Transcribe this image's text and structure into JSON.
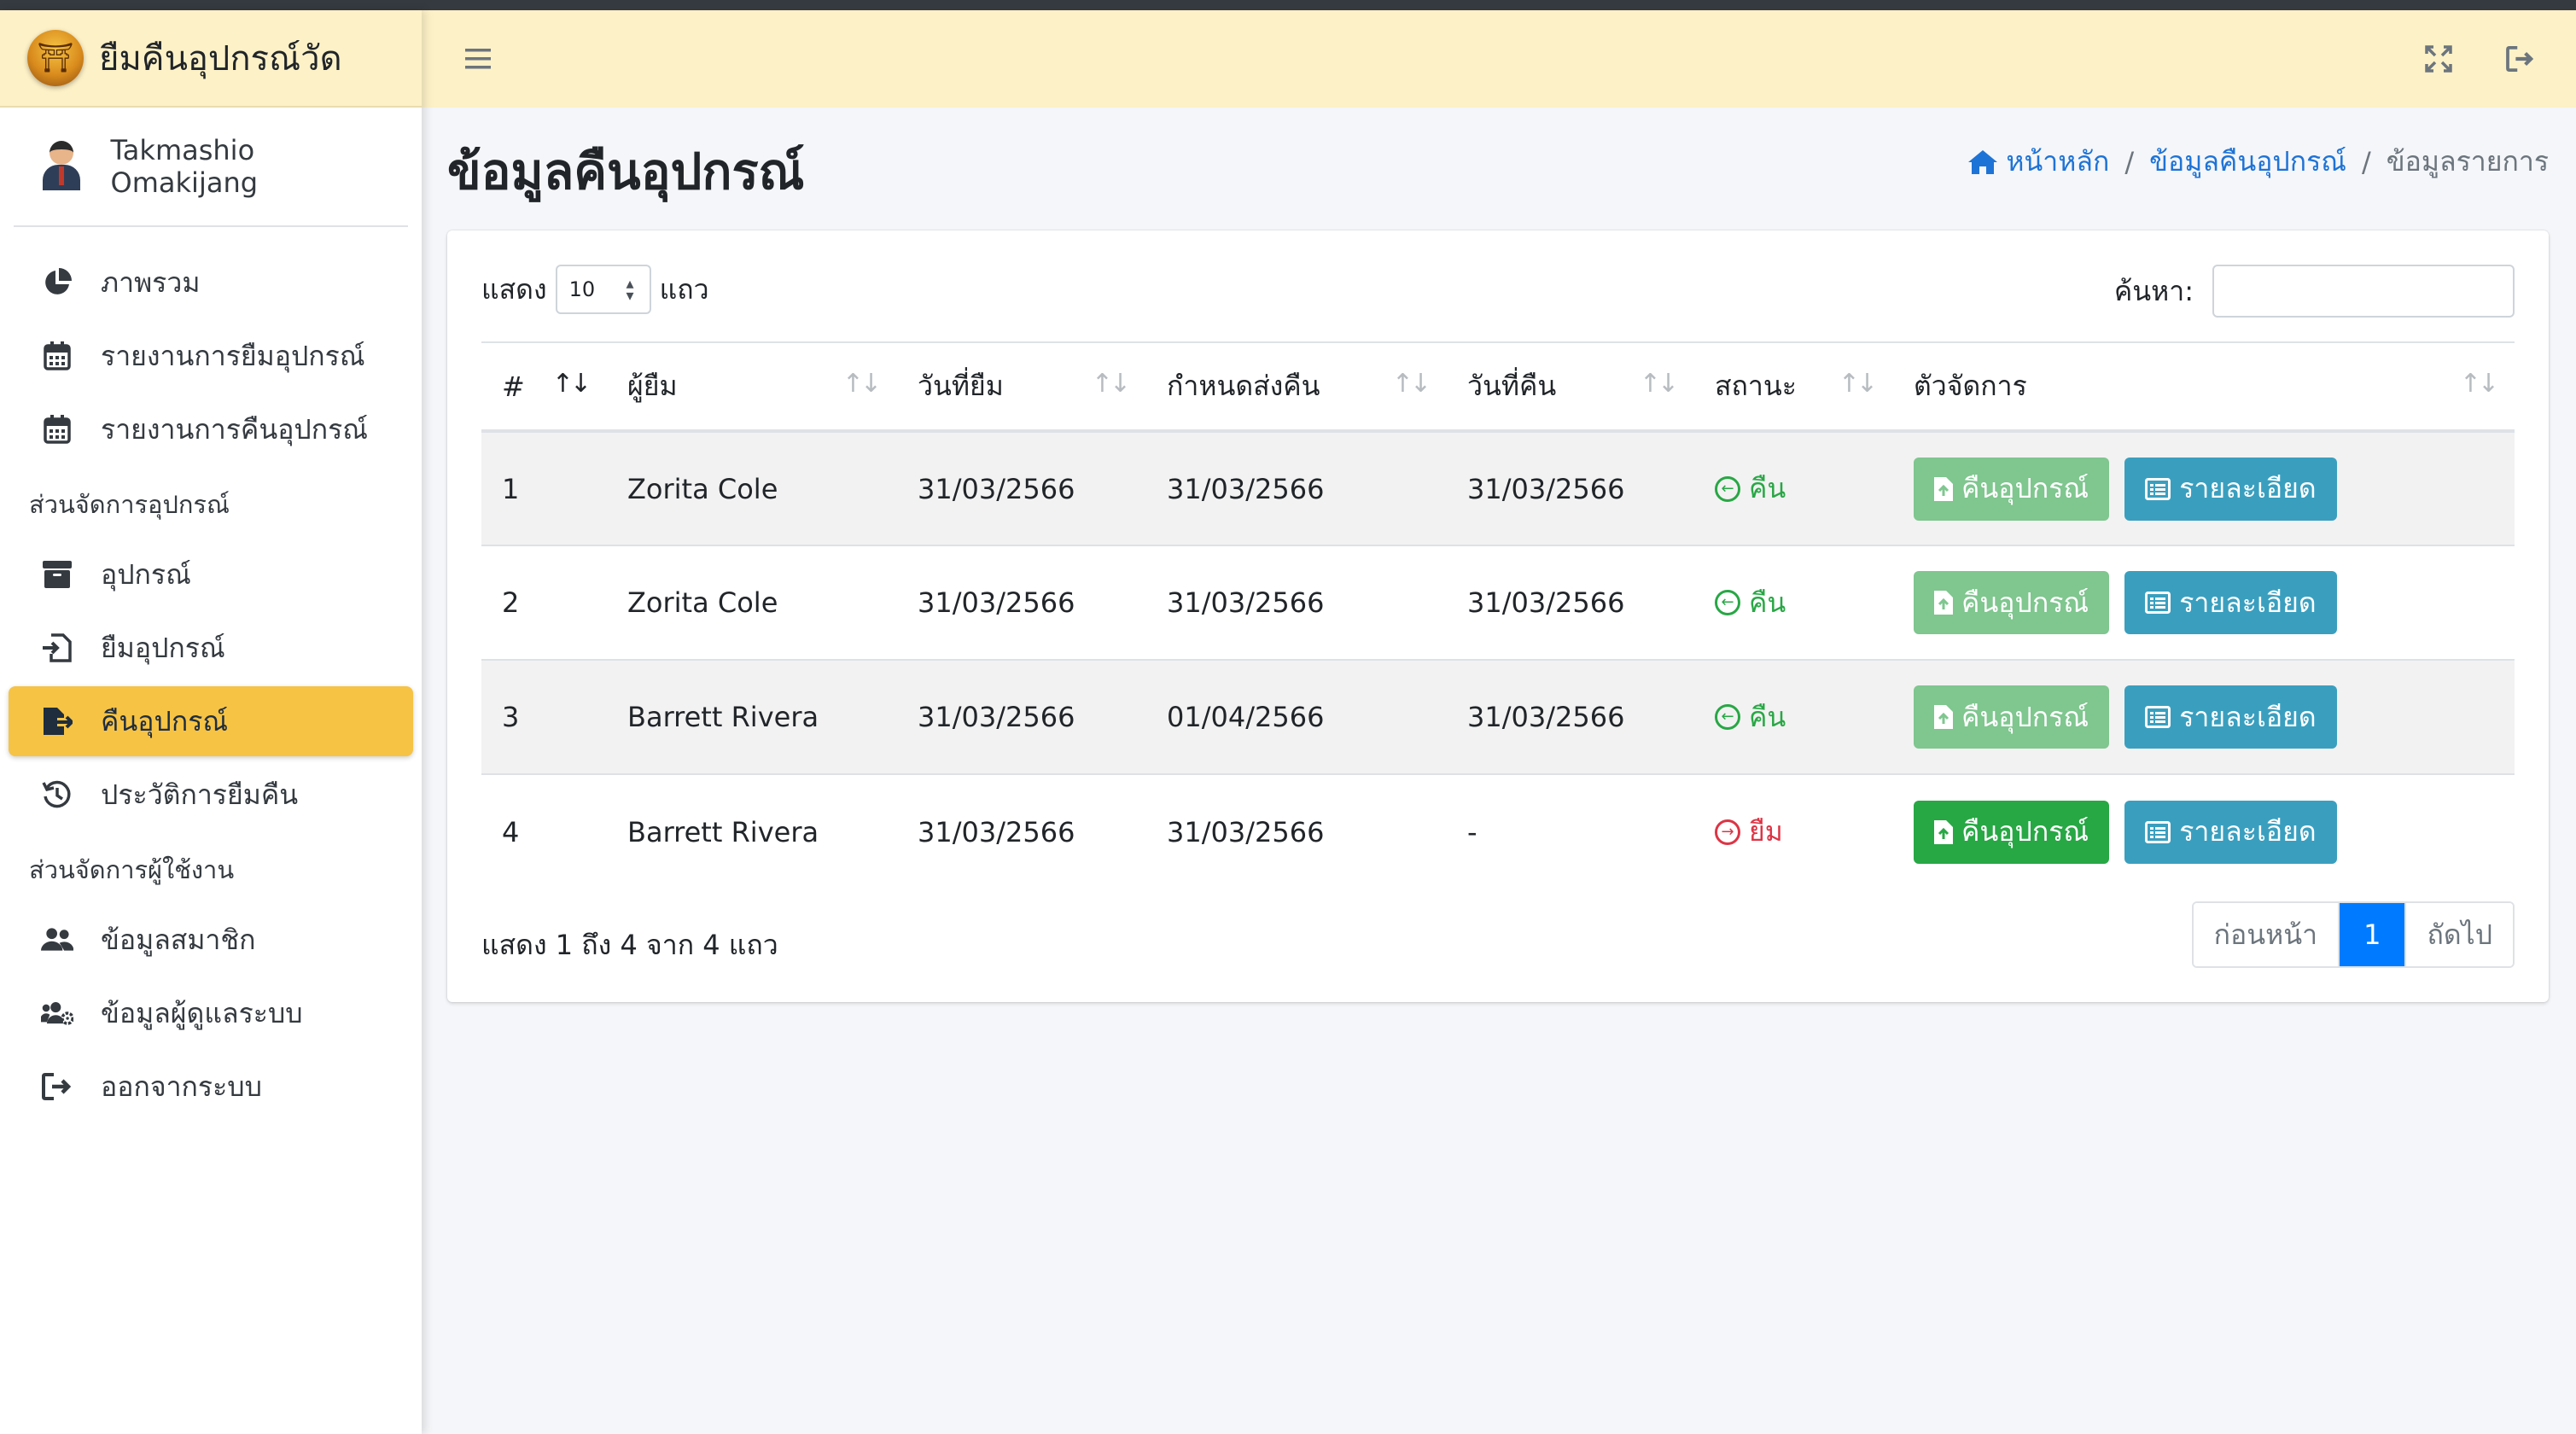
{
  "app": {
    "brand_title": "ยืมคืนอุปกรณ์วัด"
  },
  "user": {
    "name": "Takmashio Omakijang"
  },
  "sidebar": {
    "items": [
      {
        "label": "ภาพรวม",
        "icon": "chart-pie-icon"
      },
      {
        "label": "รายงานการยืมอุปกรณ์",
        "icon": "calendar-icon"
      },
      {
        "label": "รายงานการคืนอุปกรณ์",
        "icon": "calendar-icon"
      },
      {
        "label": "อุปกรณ์",
        "icon": "archive-icon"
      },
      {
        "label": "ยืมอุปกรณ์",
        "icon": "sign-in-icon"
      },
      {
        "label": "คืนอุปกรณ์",
        "icon": "file-export-icon",
        "active": true
      },
      {
        "label": "ประวัติการยืมคืน",
        "icon": "history-icon"
      },
      {
        "label": "ข้อมูลสมาชิก",
        "icon": "users-icon"
      },
      {
        "label": "ข้อมูลผู้ดูแลระบบ",
        "icon": "users-cog-icon"
      },
      {
        "label": "ออกจากระบบ",
        "icon": "sign-out-icon"
      }
    ],
    "headers": [
      "ส่วนจัดการอุปกรณ์",
      "ส่วนจัดการผู้ใช้งาน"
    ]
  },
  "page": {
    "title": "ข้อมูลคืนอุปกรณ์"
  },
  "breadcrumb": {
    "home": "หน้าหลัก",
    "section": "ข้อมูลคืนอุปกรณ์",
    "current": "ข้อมูลรายการ",
    "sep": "/"
  },
  "table_controls": {
    "show_label": "แสดง",
    "page_length": "10",
    "rows_label": "แถว",
    "search_label": "ค้นหา:",
    "search_value": ""
  },
  "table": {
    "headers": [
      "#",
      "ผู้ยืม",
      "วันที่ยืม",
      "กำหนดส่งคืน",
      "วันที่คืน",
      "สถานะ",
      "ตัวจัดการ"
    ],
    "rows": [
      {
        "no": "1",
        "borrower": "Zorita Cole",
        "borrow_date": "31/03/2566",
        "due_date": "31/03/2566",
        "return_date": "31/03/2566",
        "status": "คืน"
      },
      {
        "no": "2",
        "borrower": "Zorita Cole",
        "borrow_date": "31/03/2566",
        "due_date": "31/03/2566",
        "return_date": "31/03/2566",
        "status": "คืน"
      },
      {
        "no": "3",
        "borrower": "Barrett Rivera",
        "borrow_date": "31/03/2566",
        "due_date": "01/04/2566",
        "return_date": "31/03/2566",
        "status": "คืน"
      },
      {
        "no": "4",
        "borrower": "Barrett Rivera",
        "borrow_date": "31/03/2566",
        "due_date": "31/03/2566",
        "return_date": "-",
        "status": "ยืม"
      }
    ],
    "return_button": "คืนอุปกรณ์",
    "detail_button": "รายละเอียด"
  },
  "footer": {
    "info": "แสดง 1 ถึง 4 จาก 4 แถว",
    "prev": "ก่อนหน้า",
    "page": "1",
    "next": "ถัดไป"
  },
  "colors": {
    "topbar": "#fdf1c7",
    "active_nav": "#f6c345",
    "success": "#28a745",
    "info": "#3a9fbf",
    "danger": "#dc3545",
    "primary": "#007bff",
    "link": "#1e73d6"
  }
}
